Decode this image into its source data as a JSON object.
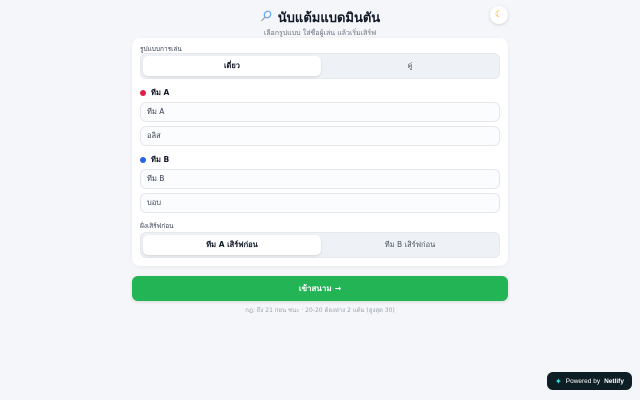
{
  "header": {
    "icon": "badminton-racket-icon",
    "title": "นับแต้มแบดมินตัน",
    "subtitle": "เลือกรูปแบบ ใส่ชื่อผู้เล่น แล้วเริ่มเสิร์ฟ",
    "theme_icon": "moon-icon"
  },
  "setup": {
    "format_label": "รูปแบบการเล่น",
    "format_options": [
      "เดี่ยว",
      "คู่"
    ],
    "format_selected": "เดี่ยว",
    "team_a": {
      "label": "ทีม A",
      "color": "#e11d48",
      "name_value": "ทีม A",
      "player_value": "อลิส"
    },
    "team_b": {
      "label": "ทีม B",
      "color": "#2563eb",
      "name_value": "ทีม B",
      "player_value": "บอบ"
    },
    "serve_label": "ฝั่งเสิร์ฟก่อน",
    "serve_options": [
      "ทีม A เสิร์ฟก่อน",
      "ทีม B เสิร์ฟก่อน"
    ],
    "serve_selected": "ทีม A เสิร์ฟก่อน"
  },
  "start_button": "เข้าสนาม →",
  "rules_text": "กฎ: ถึง 21 ก่อน ชนะ · 20-20 ต้องห่าง 2 แต้ม (สูงสุด 30)",
  "netlify": {
    "prefix": "Powered by",
    "brand": "Netlify",
    "icon": "netlify-logo-icon"
  },
  "colors": {
    "accent_green": "#22b455",
    "team_a": "#e11d48",
    "team_b": "#2563eb"
  }
}
